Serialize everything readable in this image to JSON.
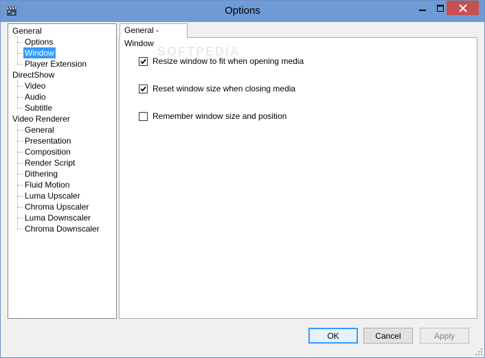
{
  "window": {
    "title": "Options"
  },
  "tree": {
    "items": [
      {
        "label": "General",
        "level": 0,
        "selected": false
      },
      {
        "label": "Options",
        "level": 1,
        "selected": false
      },
      {
        "label": "Window",
        "level": 1,
        "selected": true
      },
      {
        "label": "Player Extension",
        "level": 1,
        "selected": false
      },
      {
        "label": "DirectShow",
        "level": 0,
        "selected": false
      },
      {
        "label": "Video",
        "level": 1,
        "selected": false
      },
      {
        "label": "Audio",
        "level": 1,
        "selected": false
      },
      {
        "label": "Subtitle",
        "level": 1,
        "selected": false
      },
      {
        "label": "Video Renderer",
        "level": 0,
        "selected": false
      },
      {
        "label": "General",
        "level": 1,
        "selected": false
      },
      {
        "label": "Presentation",
        "level": 1,
        "selected": false
      },
      {
        "label": "Composition",
        "level": 1,
        "selected": false
      },
      {
        "label": "Render Script",
        "level": 1,
        "selected": false
      },
      {
        "label": "Dithering",
        "level": 1,
        "selected": false
      },
      {
        "label": "Fluid Motion",
        "level": 1,
        "selected": false
      },
      {
        "label": "Luma Upscaler",
        "level": 1,
        "selected": false
      },
      {
        "label": "Chroma Upscaler",
        "level": 1,
        "selected": false
      },
      {
        "label": "Luma Downscaler",
        "level": 1,
        "selected": false
      },
      {
        "label": "Chroma Downscaler",
        "level": 1,
        "selected": false
      }
    ]
  },
  "tab": {
    "label": "General - Window"
  },
  "watermark": "SOFTPEDIA",
  "options": [
    {
      "label": "Resize window to fit when opening media",
      "checked": true
    },
    {
      "label": "Reset window size when closing media",
      "checked": true
    },
    {
      "label": "Remember window size and position",
      "checked": false
    }
  ],
  "buttons": {
    "ok": "OK",
    "cancel": "Cancel",
    "apply": "Apply"
  },
  "colors": {
    "titlebar": "#6e9bd5",
    "selection": "#3399ff",
    "close": "#c75050"
  }
}
